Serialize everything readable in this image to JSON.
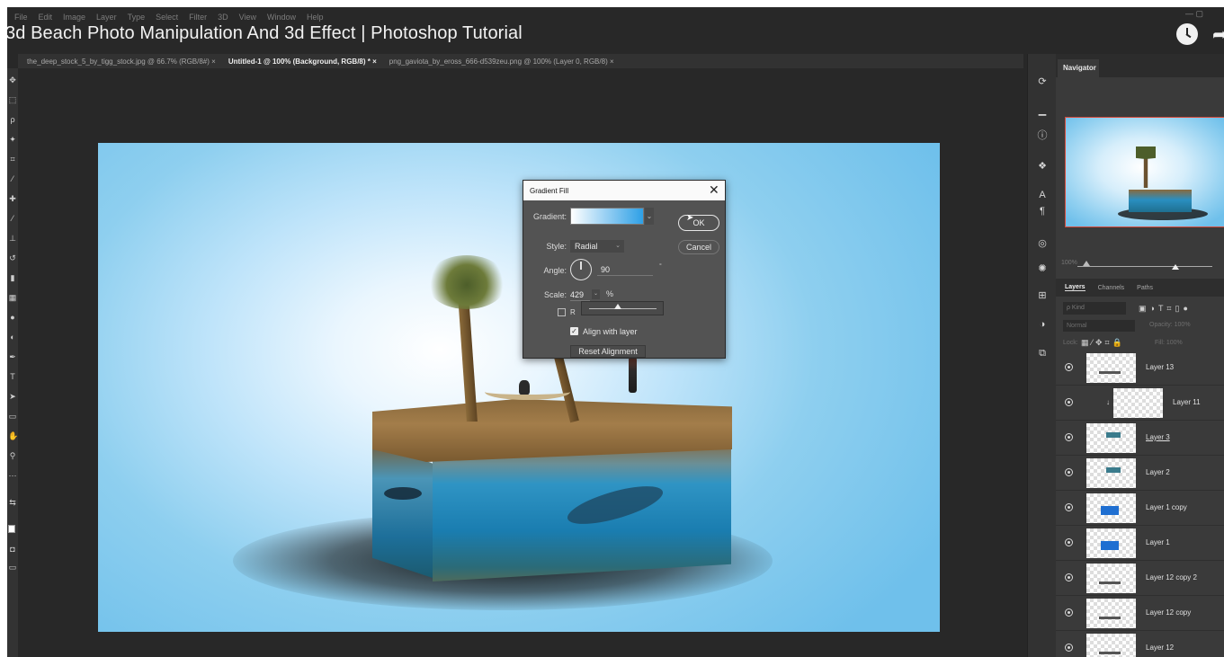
{
  "video": {
    "title": "3d Beach Photo Manipulation And 3d Effect | Photoshop Tutorial"
  },
  "menu": [
    "File",
    "Edit",
    "Image",
    "Layer",
    "Type",
    "Select",
    "Filter",
    "3D",
    "View",
    "Window",
    "Help"
  ],
  "tabs": [
    {
      "label": "the_deep_stock_5_by_tigg_stock.jpg @ 66.7% (RGB/8#)",
      "close": "×"
    },
    {
      "label": "Untitled-1 @ 100% (Background, RGB/8) *",
      "close": "×"
    },
    {
      "label": "png_gaviota_by_eross_666-d539zeu.png @ 100% (Layer 0, RGB/8)",
      "close": "×"
    }
  ],
  "dialog": {
    "title": "Gradient Fill",
    "close": "✕",
    "gradient_label": "Gradient:",
    "gradient_colors": [
      "#ffffff",
      "#2ea0e6"
    ],
    "style_label": "Style:",
    "style_value": "Radial",
    "angle_label": "Angle:",
    "angle_value": "90",
    "scale_label": "Scale:",
    "scale_value": "429",
    "scale_unit": "%",
    "reverse_letter": "R",
    "align_checked": true,
    "align_label": "Align with layer",
    "reset_label": "Reset Alignment",
    "ok_label": "OK",
    "cancel_label": "Cancel"
  },
  "panels": {
    "navigator_tab": "Navigator",
    "layer_tabs": [
      "Layers",
      "Channels",
      "Paths"
    ],
    "kind_placeholder": "ρ Kind",
    "blend_mode": "Normal",
    "opacity_label": "Opacity:",
    "opacity_value": "100%",
    "lock_label": "Lock:",
    "fill_label": "Fill:",
    "fill_value": "100%",
    "zoom_value": "100%",
    "layers": [
      {
        "name": "Layer 13",
        "visible": true
      },
      {
        "name": "Layer 11",
        "visible": true,
        "clipped": true
      },
      {
        "name": "Layer 3",
        "visible": true
      },
      {
        "name": "Layer 2",
        "visible": true
      },
      {
        "name": "Layer 1 copy",
        "visible": true
      },
      {
        "name": "Layer 1",
        "visible": true
      },
      {
        "name": "Layer 12 copy 2",
        "visible": true
      },
      {
        "name": "Layer 12 copy",
        "visible": true
      },
      {
        "name": "Layer 12",
        "visible": true
      }
    ]
  },
  "colors": {
    "canvas_bg": "#6fc0eb",
    "dialog_bg": "#535353",
    "nav_highlight": "#d84a3a"
  }
}
